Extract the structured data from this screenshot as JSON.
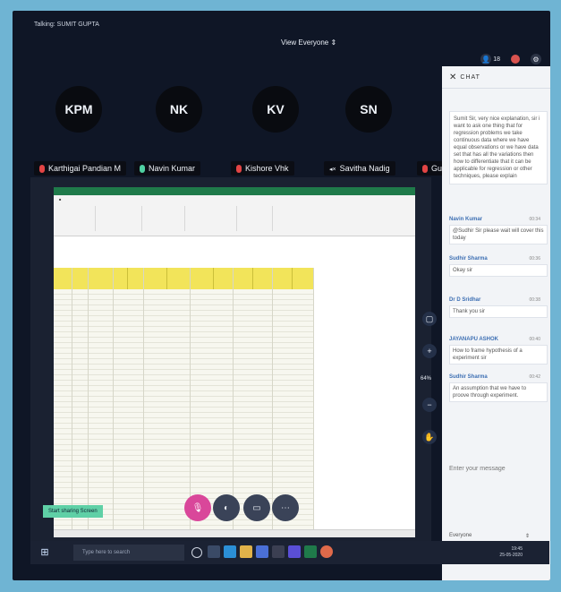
{
  "talking": "Talking: SUMIT GUPTA",
  "view_everyone": "View Everyone",
  "people_count": "18",
  "participants": [
    {
      "initials": "KPM",
      "name": "Karthigai Pandian M",
      "mic": "off"
    },
    {
      "initials": "NK",
      "name": "Navin Kumar",
      "mic": "on"
    },
    {
      "initials": "KV",
      "name": "Kishore Vhk",
      "mic": "off"
    },
    {
      "initials": "SN",
      "name": "Savitha Nadig",
      "mic": "cam"
    },
    {
      "initials": "",
      "name": "Gunjan S",
      "mic": "off"
    }
  ],
  "chat": {
    "title": "CHAT",
    "first_message": "Sumit Sir, very nice explanation, sir i want to ask one thing that for regression problems we take continuous data where we have equal observations or we have data set that has all the variations then how to differentiate that it can be applicable for regression or other techniques, please explain",
    "messages": [
      {
        "name": "Navin Kumar",
        "time": "00:34",
        "text": "@Sudhir Sir please wait will cover this today"
      },
      {
        "name": "Sudhir Sharma",
        "time": "00:36",
        "text": "Okay sir"
      },
      {
        "name": "Dr D Sridhar",
        "time": "00:38",
        "text": "Thank you sir"
      },
      {
        "name": "JAYANAPU ASHOK",
        "time": "00:40",
        "text": "How to frame hypothesis of a experiment sir"
      },
      {
        "name": "Sudhir Sharma",
        "time": "00:42",
        "text": "An assumption that we have to proove through experiment."
      }
    ],
    "input_placeholder": "Enter your message",
    "to_label": "Everyone"
  },
  "zoom": {
    "level": "64%",
    "plus": "+",
    "minus": "−"
  },
  "share_badge": "Start sharing Screen",
  "taskbar": {
    "search_placeholder": "Type here to search",
    "time": "19:45",
    "date": "25-05-2020"
  },
  "colors": {
    "header_yellow": "#f2e45a",
    "excel_green": "#1f7a4a",
    "chat_bg": "#f2f4f7",
    "mic_off": "#e34545",
    "mic_on": "#4fd0a2"
  }
}
